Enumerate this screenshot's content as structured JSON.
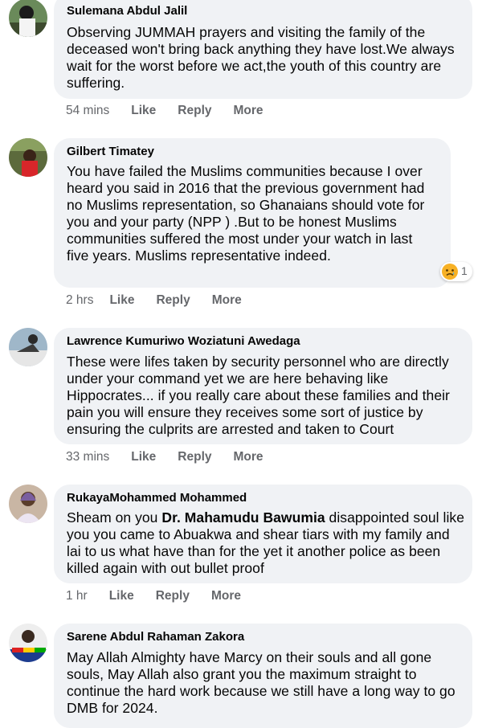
{
  "comments": [
    {
      "author": "Sulemana Abdul Jalil",
      "text": "Observing JUMMAH prayers and visiting the family of the deceased won't bring back anything they have lost.We always wait for the worst before we act,the youth of this country are suffering.",
      "time": "54 mins",
      "like": "Like",
      "reply": "Reply",
      "more": "More"
    },
    {
      "author": "Gilbert Timatey",
      "text": "You have failed the Muslims communities because I over heard you said in 2016 that the previous government had no Muslims representation, so Ghanaians should vote for you and your party (NPP ) .But to be honest Muslims communities suffered the most under your watch in last five years. Muslims representative indeed.",
      "time": "2 hrs",
      "like": "Like",
      "reply": "Reply",
      "more": "More",
      "reaction_icon": "sad-face-icon",
      "reaction_count": "1"
    },
    {
      "author": "Lawrence Kumuriwo Woziatuni Awedaga",
      "text": "These were lifes taken by security personnel who are directly under your command yet we are here behaving like Hippocrates... if you really care about these families and their pain you will ensure they receives some sort of justice by ensuring the culprits are arrested and taken to Court",
      "time": "33 mins",
      "like": "Like",
      "reply": "Reply",
      "more": "More"
    },
    {
      "author": "RukayaMohammed Mohammed",
      "text_before": "Sheam on you ",
      "mention": "Dr. Mahamudu Bawumia",
      "text_after": " disappointed soul like you you came to Abuakwa and shear tiars with my family and lai to us what have than for the yet it another police as been killed again with out bullet proof",
      "time": "1 hr",
      "like": "Like",
      "reply": "Reply",
      "more": "More"
    },
    {
      "author": "Sarene Abdul Rahaman Zakora",
      "text": "May Allah Almighty have Marcy on their souls and all gone souls, May Allah also grant you the maximum straight to continue the hard work because we still have a long way to go DMB for 2024."
    }
  ]
}
